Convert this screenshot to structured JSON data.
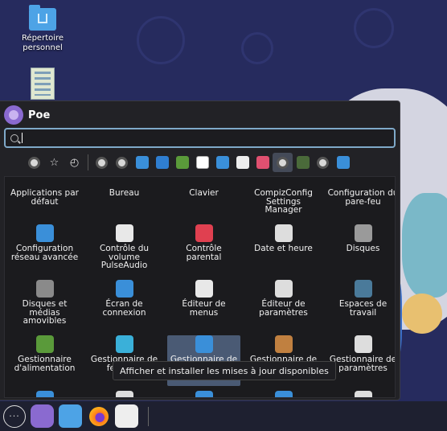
{
  "desktop": {
    "icons": [
      {
        "label": "Répertoire personnel",
        "icon": "home-folder-icon"
      },
      {
        "label": "",
        "icon": "spreadsheet-file-icon"
      }
    ]
  },
  "menu": {
    "user_name": "Poe",
    "search": {
      "value": "",
      "placeholder": ""
    },
    "categories": [
      {
        "icon": "settings-category-icon"
      },
      {
        "icon": "favorites-star-icon"
      },
      {
        "icon": "recent-clock-icon"
      }
    ],
    "apps": [
      {
        "label": "Applications par défaut",
        "icon": "default-apps-icon",
        "color": "#888888"
      },
      {
        "label": "Bureau",
        "icon": "desktop-icon",
        "color": "#3a8fd9"
      },
      {
        "label": "Clavier",
        "icon": "keyboard-icon",
        "color": "#888888"
      },
      {
        "label": "CompizConfig Settings Manager",
        "icon": "compizconfig-icon",
        "color": "#3a8fd9"
      },
      {
        "label": "Configuration du pare-feu",
        "icon": "firewall-icon",
        "color": "#d9534f"
      },
      {
        "label": "Configuration réseau avancée",
        "icon": "network-config-icon",
        "color": "#3a8fd9"
      },
      {
        "label": "Contrôle du volume PulseAudio",
        "icon": "volume-control-icon",
        "color": "#e8e8e8"
      },
      {
        "label": "Contrôle parental",
        "icon": "parental-control-icon",
        "color": "#e04050"
      },
      {
        "label": "Date et heure",
        "icon": "clock-icon",
        "color": "#dddddd"
      },
      {
        "label": "Disques",
        "icon": "disks-icon",
        "color": "#9a9a9a"
      },
      {
        "label": "Disques et médias amovibles",
        "icon": "removable-media-icon",
        "color": "#8a8a8a"
      },
      {
        "label": "Écran de connexion",
        "icon": "login-screen-icon",
        "color": "#3a8fd9"
      },
      {
        "label": "Éditeur de menus",
        "icon": "menu-editor-icon",
        "color": "#e8e8e8"
      },
      {
        "label": "Éditeur de paramètres",
        "icon": "dconf-editor-icon",
        "color": "#dddddd"
      },
      {
        "label": "Espaces de travail",
        "icon": "workspaces-icon",
        "color": "#4a7a9a"
      },
      {
        "label": "Gestionnaire d'alimentation",
        "icon": "power-manager-icon",
        "color": "#5a9a3a"
      },
      {
        "label": "Gestionnaire de fenêtres",
        "icon": "window-manager-icon",
        "color": "#3ab0d9"
      },
      {
        "label": "Gestionnaire de mises à jour",
        "icon": "update-manager-icon",
        "color": "#3a8fd9"
      },
      {
        "label": "Gestionnaire de paquets",
        "icon": "package-manager-icon",
        "color": "#c08040"
      },
      {
        "label": "Gestionnaire de paramètres",
        "icon": "settings-manager-icon",
        "color": "#dddddd"
      },
      {
        "label": "",
        "icon": "app-icon-a",
        "color": "#3a8fd9"
      },
      {
        "label": "",
        "icon": "printer-icon",
        "color": "#dddddd"
      },
      {
        "label": "",
        "icon": "app-icon-c",
        "color": "#3a8fd9"
      },
      {
        "label": "",
        "icon": "app-store-icon",
        "color": "#3a8fd9"
      },
      {
        "label": "",
        "icon": "app-icon-e",
        "color": "#dddddd"
      }
    ],
    "tooltip": "Afficher et installer les mises à jour disponibles"
  },
  "taskbar": {
    "items": [
      {
        "icon": "apps-grid-icon"
      },
      {
        "icon": "user-avatar-icon"
      },
      {
        "icon": "files-folder-icon"
      },
      {
        "icon": "firefox-icon"
      },
      {
        "icon": "system-monitor-icon"
      }
    ]
  }
}
